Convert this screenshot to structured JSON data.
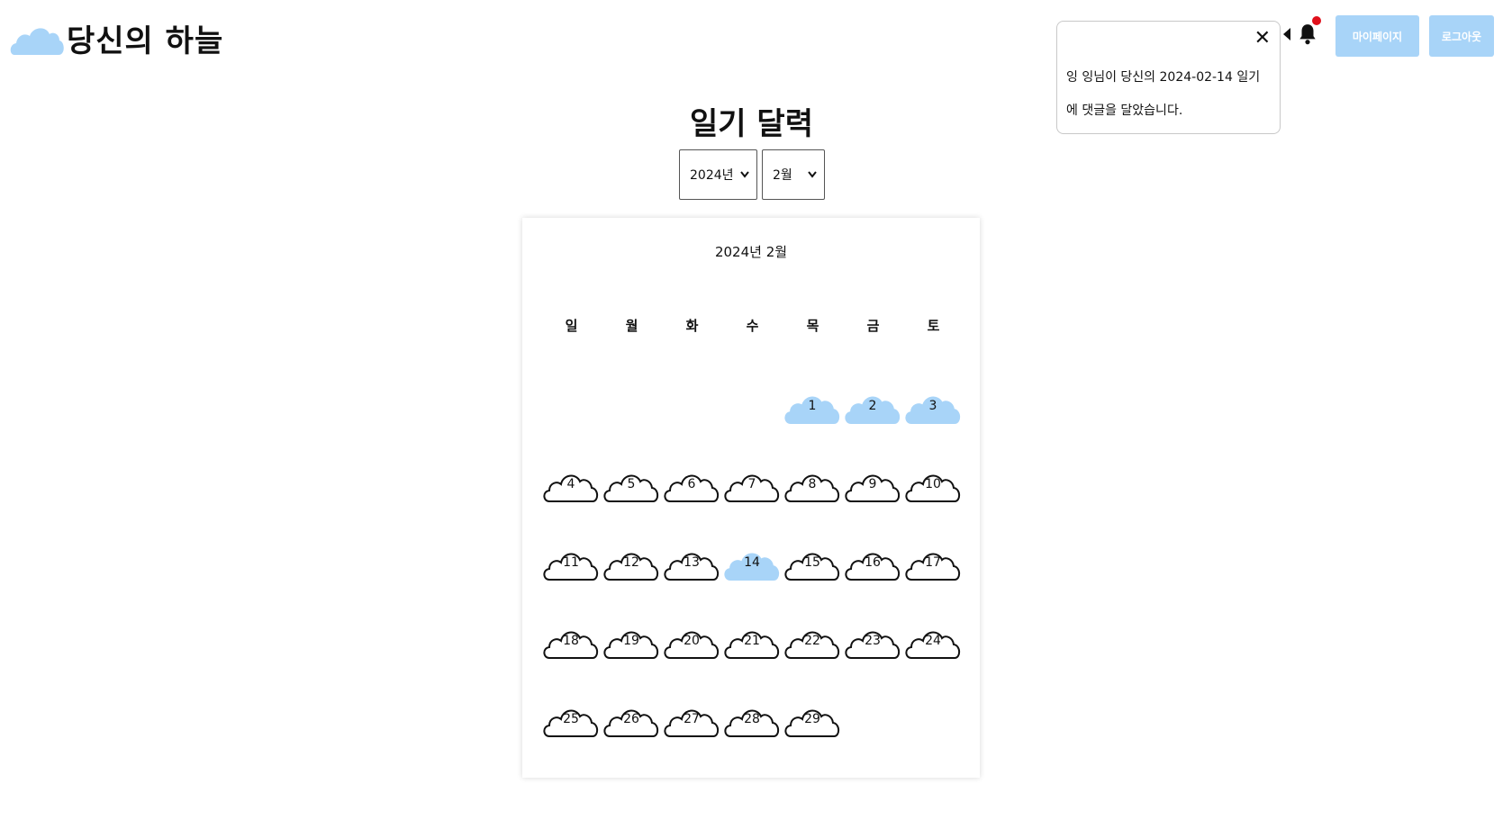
{
  "app": {
    "title": "당신의 하늘"
  },
  "header": {
    "mypage_label": "마이페이지",
    "logout_label": "로그아웃"
  },
  "notification": {
    "message": "잉 잉님이 당신의 2024-02-14 일기에 댓글을 달았습니다."
  },
  "page": {
    "title": "일기 달력"
  },
  "selectors": {
    "year": "2024년",
    "month": "2월"
  },
  "calendar": {
    "header": "2024년   2월",
    "weekdays": [
      "일",
      "월",
      "화",
      "수",
      "목",
      "금",
      "토"
    ],
    "first_weekday_index": 4,
    "days_in_month": 29,
    "filled_days": [
      1,
      2,
      3,
      14
    ]
  },
  "colors": {
    "accent": "#a8d4f8",
    "cloud_fill": "#a8d4f8",
    "notification_dot": "#e0101b"
  }
}
